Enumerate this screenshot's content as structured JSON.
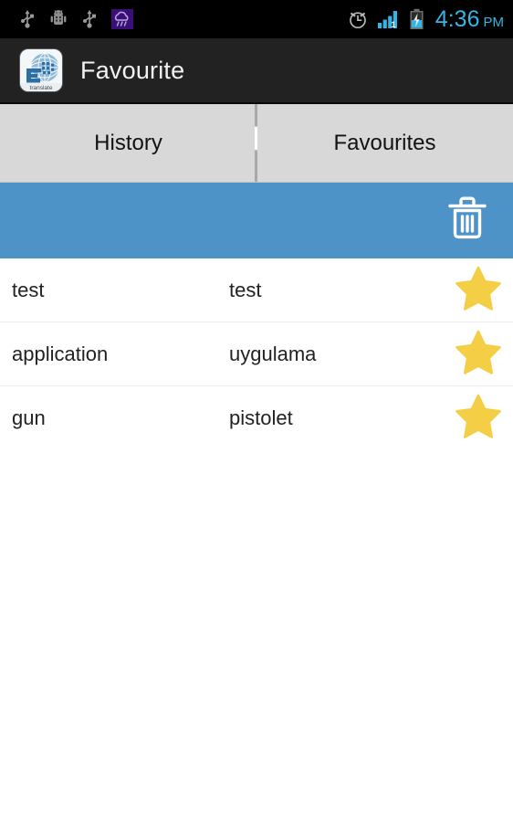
{
  "status_bar": {
    "left_icons": [
      {
        "name": "usb-icon",
        "label": "USB"
      },
      {
        "name": "android-debug-icon",
        "label": "Android debugging"
      },
      {
        "name": "usb-icon",
        "label": "USB"
      },
      {
        "name": "weather-rain-icon",
        "label": "Rain"
      }
    ],
    "right_icons": [
      {
        "name": "alarm-clock-icon",
        "label": "Alarm set"
      },
      {
        "name": "signal-bars-icon",
        "label": "Signal",
        "sim_label": "1"
      },
      {
        "name": "battery-charging-icon",
        "label": "Battery charging"
      }
    ],
    "time": "4:36",
    "ampm": "PM",
    "clock_color": "#33b5e5"
  },
  "app_bar": {
    "icon_name": "translate-app-icon",
    "icon_caption": "translate",
    "title": "Favourite",
    "background": "#222222"
  },
  "tabs": {
    "items": [
      {
        "label": "History",
        "selected": false
      },
      {
        "label": "Favourites",
        "selected": true
      }
    ],
    "background": "#d8d8d8"
  },
  "action_bar": {
    "background": "#4d93c8",
    "delete_icon_name": "trash-icon",
    "delete_label": "Delete"
  },
  "favourites": {
    "star_color": "#f4ce45",
    "rows": [
      {
        "source": "test",
        "target": "test",
        "starred": true
      },
      {
        "source": "application",
        "target": "uygulama",
        "starred": true
      },
      {
        "source": "gun",
        "target": "pistolet",
        "starred": true
      }
    ]
  }
}
